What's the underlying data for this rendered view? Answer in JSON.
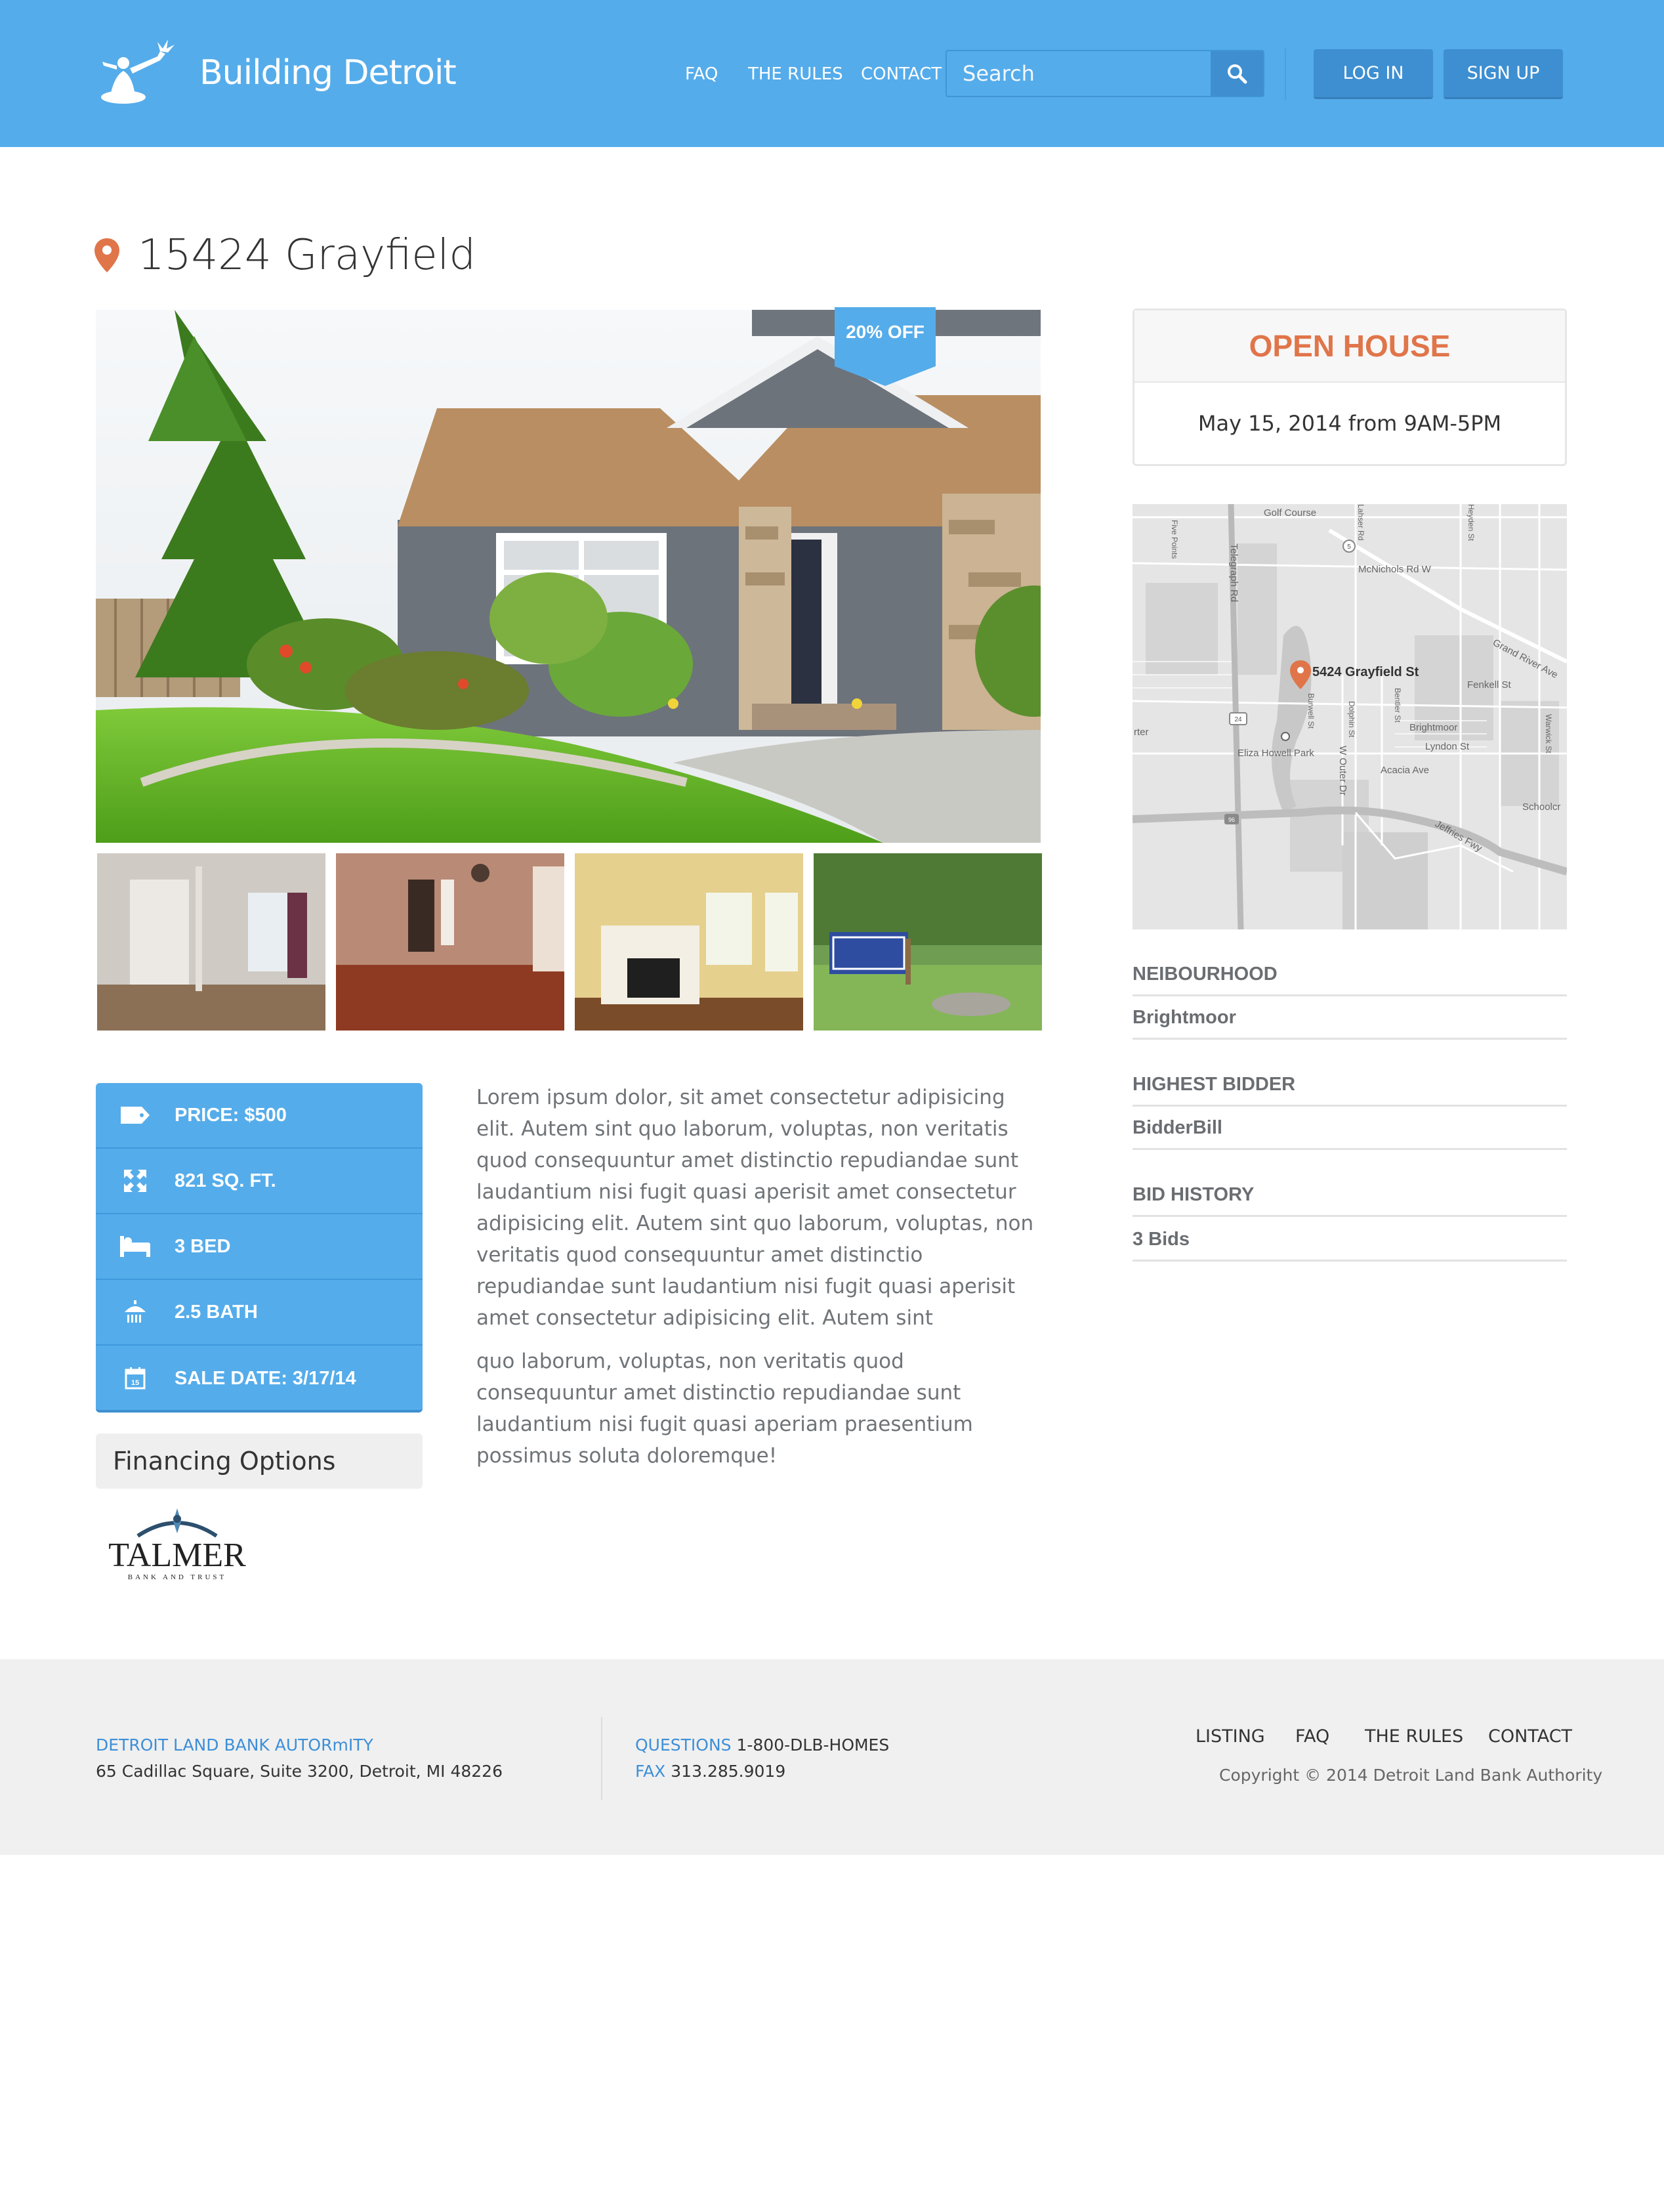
{
  "header": {
    "brand": "Building Detroit",
    "nav": [
      "FAQ",
      "THE RULES",
      "CONTACT"
    ],
    "search_placeholder": "Search",
    "login_label": "LOG IN",
    "signup_label": "SIGN UP",
    "icons": {
      "search": "search-icon",
      "logo": "spirit-of-detroit-logo"
    }
  },
  "listing": {
    "title": "15424 Grayfield",
    "badge": "20% OFF",
    "details": [
      {
        "icon": "price-tag-icon",
        "label": "PRICE: $500"
      },
      {
        "icon": "expand-icon",
        "label": "821 SQ. FT."
      },
      {
        "icon": "bed-icon",
        "label": "3 BED"
      },
      {
        "icon": "shower-icon",
        "label": "2.5 BATH"
      },
      {
        "icon": "calendar-icon",
        "label": "SALE DATE: 3/17/14"
      }
    ],
    "financing_label": "Financing Options",
    "sponsor_logo": {
      "name": "TALMER",
      "sub": "BANK AND TRUST"
    },
    "description": [
      "Lorem ipsum dolor, sit amet consectetur adipisicing elit. Autem sint quo laborum, voluptas, non veritatis quod consequuntur amet distinctio repudiandae sunt laudantium nisi fugit quasi aperisit amet consectetur adipisicing elit. Autem sint quo laborum, voluptas, non veritatis quod consequuntur amet distinctio repudiandae sunt laudantium nisi fugit quasi aperisit amet consectetur adipisicing elit. Autem sint",
      "quo laborum, voluptas, non veritatis quod consequuntur amet distinctio repudiandae sunt laudantium nisi fugit quasi aperiam praesentium possimus soluta doloremque!"
    ]
  },
  "open_house": {
    "heading": "OPEN HOUSE",
    "when": "May 15, 2014 from 9AM-5PM"
  },
  "map": {
    "address_label": "5424 Grayfield St",
    "streets": [
      "Golf Course",
      "McNichols Rd W",
      "Grand River Ave",
      "Fenkell St",
      "Brightmoor",
      "Lyndon St",
      "Acacia Ave",
      "Eliza Howell Park",
      "Telegraph Rd",
      "Schoolcr",
      "Jeffries Fwy",
      "W Outer Dr",
      "Five Points",
      "Heyden St",
      "Bentler St",
      "Dolphin St",
      "Burwell St",
      "Warwick St",
      "Lahser Rd",
      "rter",
      "24",
      "5",
      "96"
    ]
  },
  "facts": [
    {
      "label": "NEIBOURHOOD",
      "value": "Brightmoor"
    },
    {
      "label": "HIGHEST BIDDER",
      "value": "BidderBill"
    },
    {
      "label": "BID HISTORY",
      "value": "3 Bids"
    }
  ],
  "footer": {
    "org": "DETROIT LAND BANK AUTORmITY",
    "address": "65 Cadillac Square, Suite 3200, Detroit, MI 48226",
    "questions_label": "QUESTIONS",
    "questions_value": "1-800-DLB-HOMES",
    "fax_label": "FAX",
    "fax_value": "313.285.9019",
    "nav": [
      "LISTING",
      "FAQ",
      "THE RULES",
      "CONTACT"
    ],
    "copyright": "Copyright © 2014 Detroit Land Bank Authority"
  },
  "colors": {
    "brand_blue": "#55acea",
    "accent_orange": "#e0754a",
    "footer_bg": "#f0f0f0"
  }
}
